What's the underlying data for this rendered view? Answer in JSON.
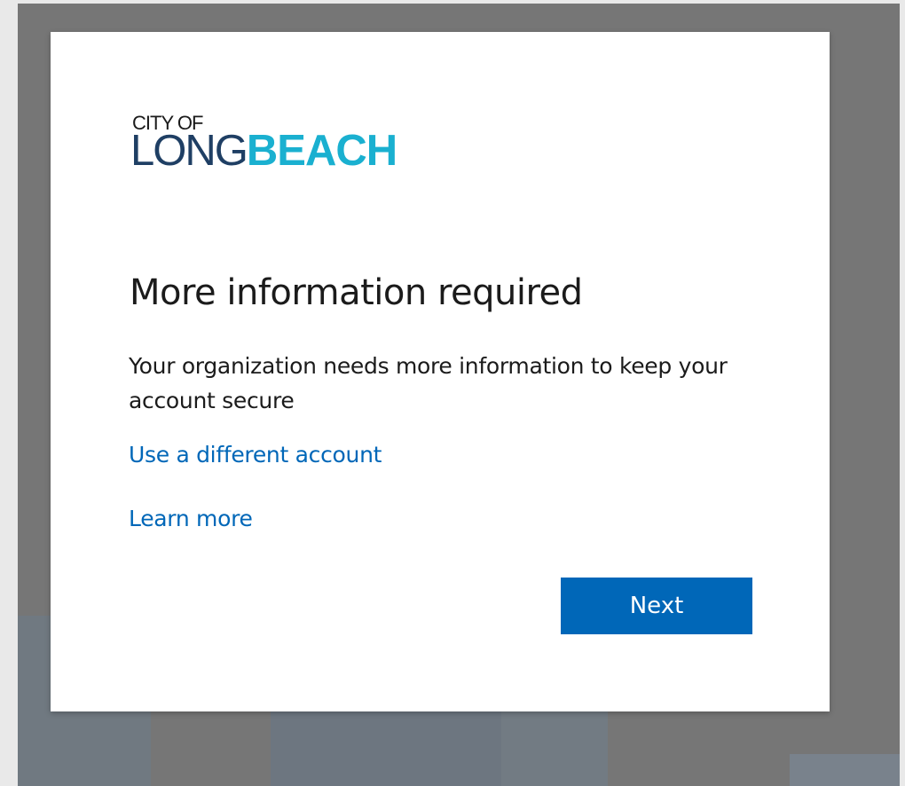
{
  "logo": {
    "top_text": "CITY OF",
    "long_text": "LONG",
    "beach_text": "BEACH",
    "colors": {
      "long": "#1f3f64",
      "beach": "#1ab0d0"
    }
  },
  "title": "More information required",
  "description": "Your organization needs more information to keep your account secure",
  "links": {
    "different_account": "Use a different account",
    "learn_more": "Learn more"
  },
  "buttons": {
    "next": "Next"
  },
  "colors": {
    "accent": "#0067b8",
    "backdrop": "#767676",
    "card": "#ffffff"
  }
}
